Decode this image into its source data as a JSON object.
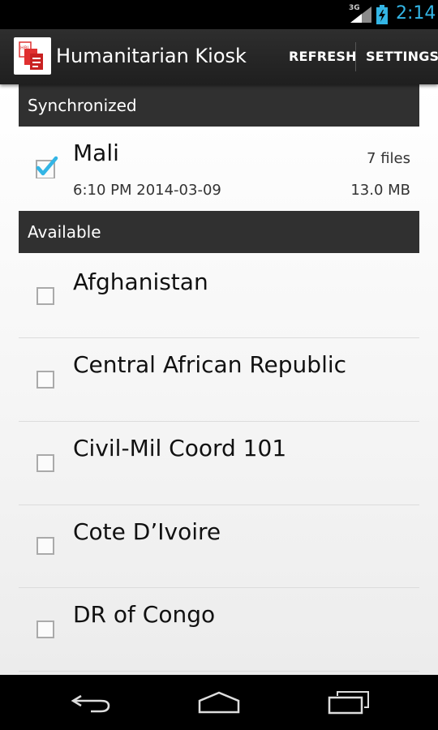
{
  "status_bar": {
    "network": "3G",
    "time": "2:14",
    "icons": [
      "signal-icon",
      "battery-charging-icon"
    ]
  },
  "action_bar": {
    "app_icon": "humanitarian-kiosk-app-icon",
    "title": "Humanitarian Kiosk",
    "refresh_label": "REFRESH",
    "settings_label": "SETTINGS"
  },
  "sections": {
    "synchronized": {
      "header": "Synchronized",
      "items": [
        {
          "title": "Mali",
          "checked": true,
          "file_count": "7 files",
          "timestamp": "6:10 PM 2014-03-09",
          "size": "13.0 MB"
        }
      ]
    },
    "available": {
      "header": "Available",
      "items": [
        {
          "title": "Afghanistan",
          "checked": false
        },
        {
          "title": "Central African Republic",
          "checked": false
        },
        {
          "title": "Civil-Mil Coord 101",
          "checked": false
        },
        {
          "title": "Cote D’Ivoire",
          "checked": false
        },
        {
          "title": "DR of Congo",
          "checked": false
        }
      ]
    }
  },
  "nav_bar": {
    "icons": [
      "back-icon",
      "home-icon",
      "recent-apps-icon"
    ]
  },
  "colors": {
    "accent": "#33b5e5",
    "header_bg": "#303030",
    "action_bar_bg": "#262626"
  }
}
